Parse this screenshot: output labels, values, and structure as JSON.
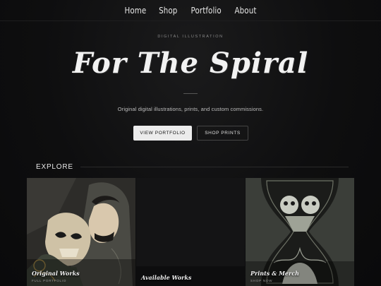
{
  "nav": {
    "items": [
      "Home",
      "Shop",
      "Portfolio",
      "About"
    ]
  },
  "hero": {
    "eyebrow": "DIGITAL ILLUSTRATION",
    "title": "For The Spiral",
    "subtitle": "Original digital illustrations, prints, and custom commissions.",
    "primary_button": "VIEW PORTFOLIO",
    "secondary_button": "SHOP PRINTS"
  },
  "explore": {
    "heading": "EXPLORE",
    "cards": [
      {
        "title": "Original Works",
        "subtitle": "FULL PORTFOLIO"
      },
      {
        "title": "Available Works",
        "subtitle": ""
      },
      {
        "title": "Prints & Merch",
        "subtitle": "SHOP NOW"
      }
    ]
  },
  "colors": {
    "background": "#0c0c0d",
    "primary_button_bg": "#ececec",
    "text": "#e6e6e6"
  }
}
